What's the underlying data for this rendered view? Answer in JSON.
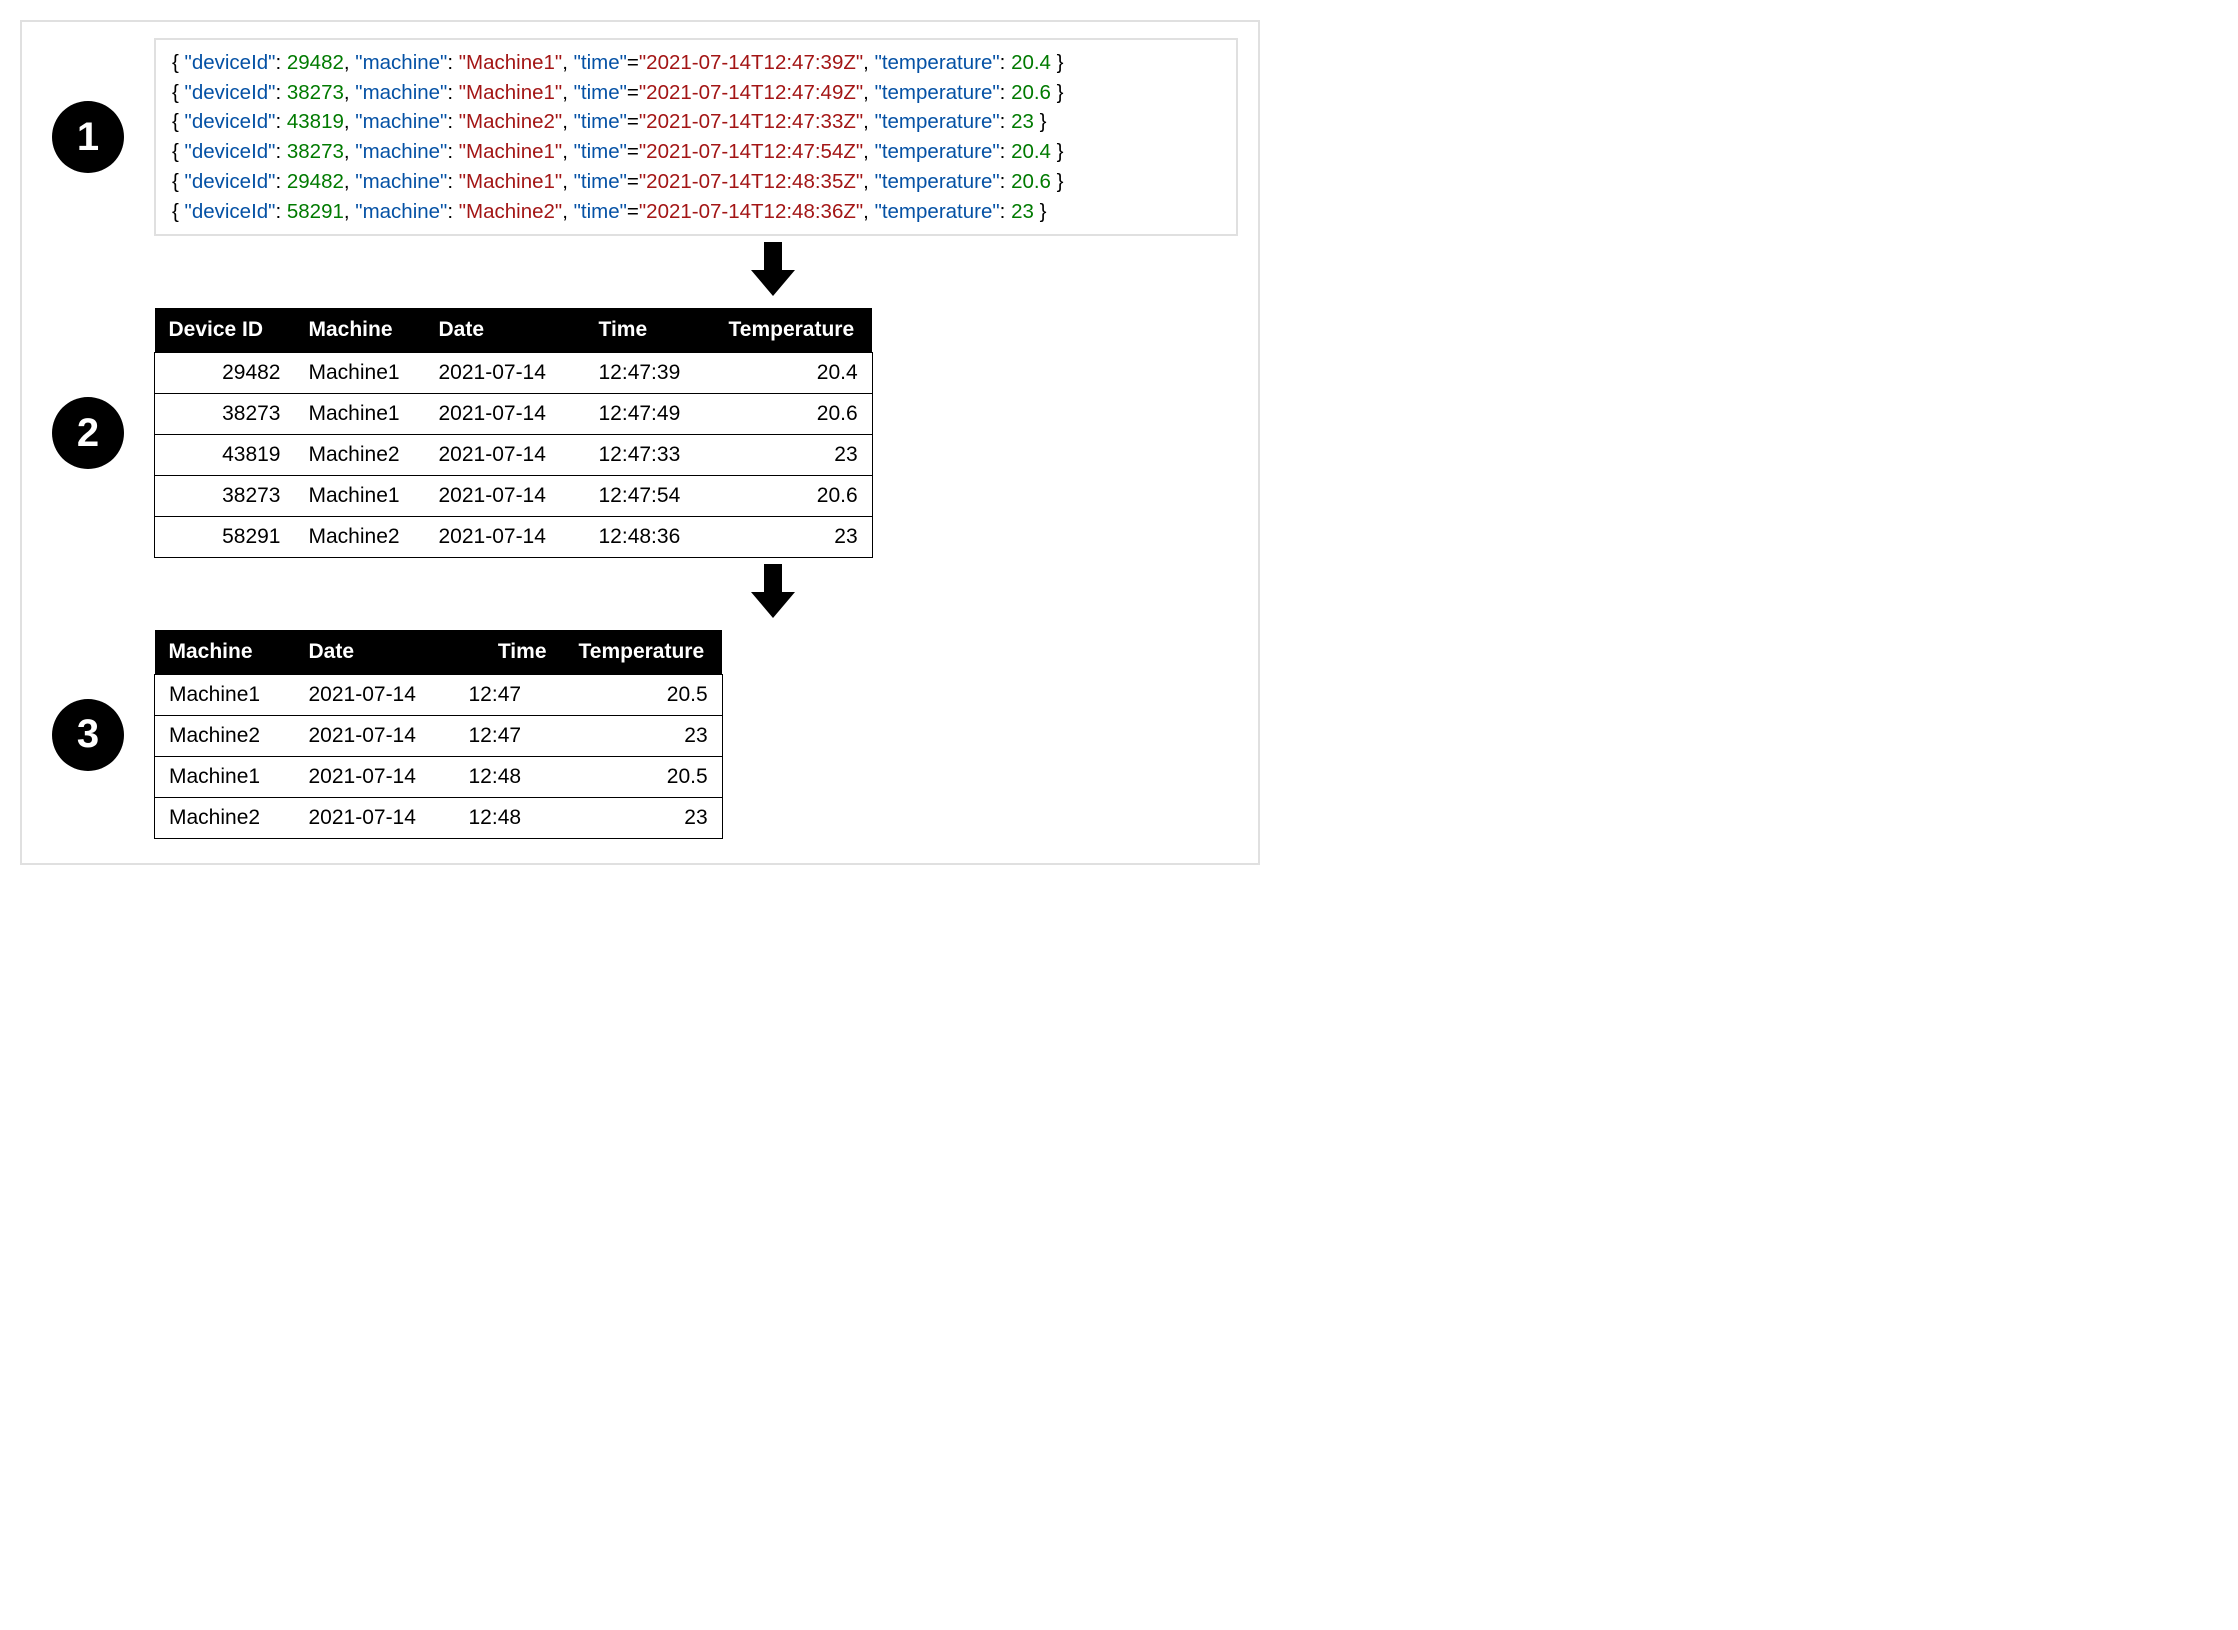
{
  "steps": {
    "one": "1",
    "two": "2",
    "three": "3"
  },
  "json_keys": {
    "deviceId": "\"deviceId\"",
    "machine": "\"machine\"",
    "time": "\"time\"",
    "temperature": "\"temperature\""
  },
  "json_rows": [
    {
      "deviceId": "29482",
      "machine": "\"Machine1\"",
      "time": "\"2021-07-14T12:47:39Z\"",
      "temperature": "20.4"
    },
    {
      "deviceId": "38273",
      "machine": "\"Machine1\"",
      "time": "\"2021-07-14T12:47:49Z\"",
      "temperature": "20.6"
    },
    {
      "deviceId": "43819",
      "machine": "\"Machine2\"",
      "time": "\"2021-07-14T12:47:33Z\"",
      "temperature": "23"
    },
    {
      "deviceId": "38273",
      "machine": "\"Machine1\"",
      "time": "\"2021-07-14T12:47:54Z\"",
      "temperature": "20.4"
    },
    {
      "deviceId": "29482",
      "machine": "\"Machine1\"",
      "time": "\"2021-07-14T12:48:35Z\"",
      "temperature": "20.6"
    },
    {
      "deviceId": "58291",
      "machine": "\"Machine2\"",
      "time": "\"2021-07-14T12:48:36Z\"",
      "temperature": "23"
    }
  ],
  "table1": {
    "headers": {
      "device_id": "Device ID",
      "machine": "Machine",
      "date": "Date",
      "time": "Time",
      "temperature": "Temperature"
    },
    "rows": [
      {
        "device_id": "29482",
        "machine": "Machine1",
        "date": "2021-07-14",
        "time": "12:47:39",
        "temperature": "20.4"
      },
      {
        "device_id": "38273",
        "machine": "Machine1",
        "date": "2021-07-14",
        "time": "12:47:49",
        "temperature": "20.6"
      },
      {
        "device_id": "43819",
        "machine": "Machine2",
        "date": "2021-07-14",
        "time": "12:47:33",
        "temperature": "23"
      },
      {
        "device_id": "38273",
        "machine": "Machine1",
        "date": "2021-07-14",
        "time": "12:47:54",
        "temperature": "20.6"
      },
      {
        "device_id": "58291",
        "machine": "Machine2",
        "date": "2021-07-14",
        "time": "12:48:36",
        "temperature": "23"
      }
    ]
  },
  "table2": {
    "headers": {
      "machine": "Machine",
      "date": "Date",
      "time": "Time",
      "temperature": "Temperature"
    },
    "rows": [
      {
        "machine": "Machine1",
        "date": "2021-07-14",
        "time": "12:47",
        "temperature": "20.5"
      },
      {
        "machine": "Machine2",
        "date": "2021-07-14",
        "time": "12:47",
        "temperature": "23"
      },
      {
        "machine": "Machine1",
        "date": "2021-07-14",
        "time": "12:48",
        "temperature": "20.5"
      },
      {
        "machine": "Machine2",
        "date": "2021-07-14",
        "time": "12:48",
        "temperature": "23"
      }
    ]
  }
}
